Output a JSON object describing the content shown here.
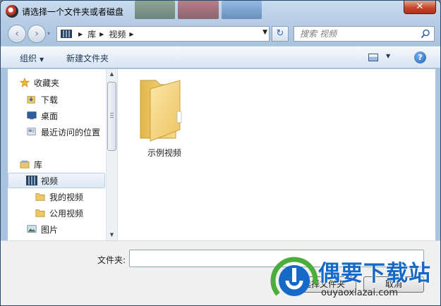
{
  "window": {
    "title": "请选择一个文件夹或者磁盘",
    "close_label": "✕"
  },
  "address_bar": {
    "crumbs": [
      "库",
      "视频"
    ],
    "search_placeholder": "搜索 视频"
  },
  "toolbar": {
    "organize_label": "组织",
    "new_folder_label": "新建文件夹",
    "help_label": "?"
  },
  "nav_pane": {
    "favorites": {
      "label": "收藏夹",
      "items": [
        {
          "label": "下载",
          "icon": "download-folder-icon"
        },
        {
          "label": "桌面",
          "icon": "desktop-icon"
        },
        {
          "label": "最近访问的位置",
          "icon": "recent-places-icon"
        }
      ]
    },
    "libraries": {
      "label": "库",
      "items": [
        {
          "label": "视频",
          "icon": "video-library-icon",
          "selected": true
        },
        {
          "label": "我的视频",
          "icon": "folder-icon",
          "indent": true
        },
        {
          "label": "公用视频",
          "icon": "folder-icon",
          "indent": true
        },
        {
          "label": "图片",
          "icon": "pictures-library-icon"
        }
      ]
    }
  },
  "content": {
    "items": [
      {
        "label": "示例视频",
        "icon": "folder-icon"
      }
    ]
  },
  "bottom": {
    "folder_label": "文件夹:",
    "folder_value": "",
    "select_button": "选择文件夹",
    "cancel_button": "取消"
  },
  "watermark": {
    "brand": "偶要下载站",
    "url": "ouyaoxiazai.com"
  },
  "colors": {
    "frame": "#b7cde5",
    "toolbar_text": "#1e395b",
    "watermark_blue": "#1769c7",
    "close_red": "#c7452c"
  }
}
